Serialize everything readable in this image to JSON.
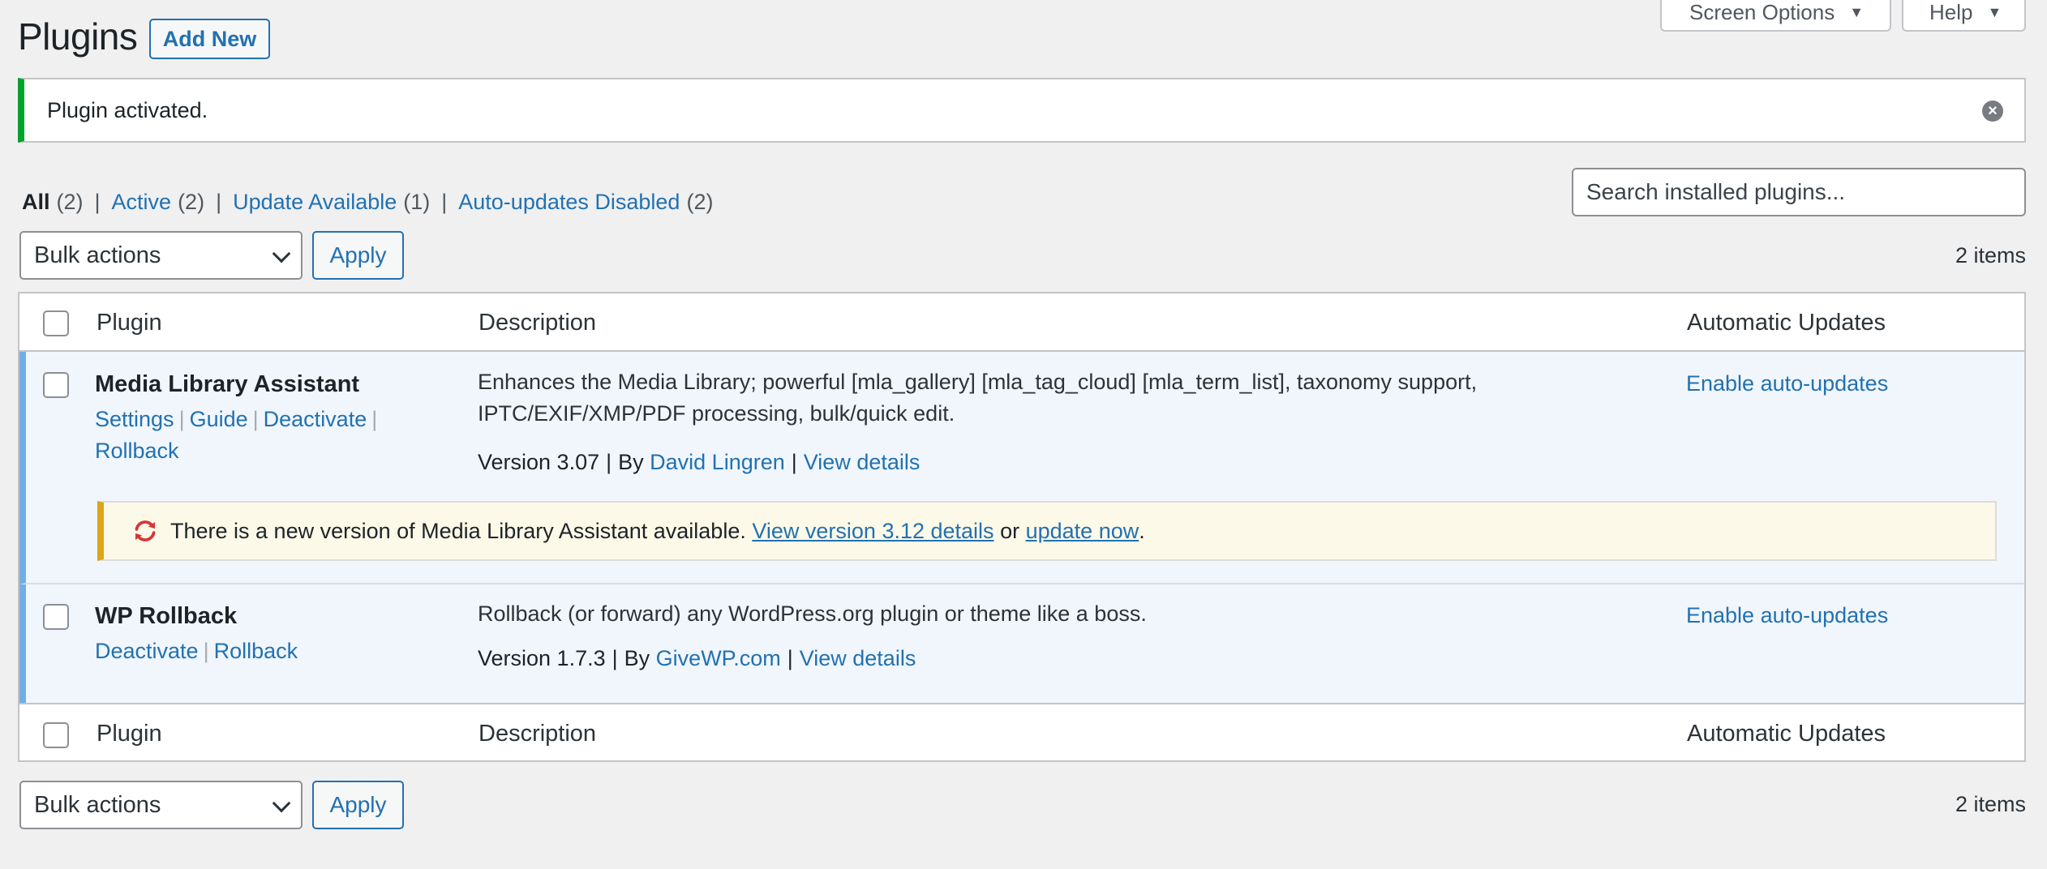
{
  "screen_options": {
    "label": "Screen Options"
  },
  "help": {
    "label": "Help"
  },
  "page": {
    "title": "Plugins",
    "add_new": "Add New"
  },
  "notice": {
    "message": "Plugin activated."
  },
  "filters": {
    "all": {
      "label": "All",
      "count": "(2)"
    },
    "active": {
      "label": "Active",
      "count": "(2)"
    },
    "update_available": {
      "label": "Update Available",
      "count": "(1)"
    },
    "auto_updates_disabled": {
      "label": "Auto-updates Disabled",
      "count": "(2)"
    }
  },
  "search": {
    "placeholder": "Search installed plugins..."
  },
  "bulk": {
    "selected": "Bulk actions",
    "apply": "Apply",
    "items": "2 items"
  },
  "columns": {
    "plugin": "Plugin",
    "description": "Description",
    "auto_updates": "Automatic Updates"
  },
  "plugins": [
    {
      "name": "Media Library Assistant",
      "actions": [
        "Settings",
        "Guide",
        "Deactivate",
        "Rollback"
      ],
      "description_line1": "Enhances the Media Library; powerful [mla_gallery] [mla_tag_cloud] [mla_term_list], taxonomy support,",
      "description_line2": "IPTC/EXIF/XMP/PDF processing, bulk/quick edit.",
      "version": "Version 3.07",
      "by": "By",
      "author": "David Lingren",
      "view_details": "View details",
      "auto_updates": "Enable auto-updates",
      "update": {
        "text": "There is a new version of Media Library Assistant available.",
        "details_link": "View version 3.12 details",
        "or": "or",
        "update_link": "update now",
        "period": "."
      }
    },
    {
      "name": "WP Rollback",
      "actions": [
        "Deactivate",
        "Rollback"
      ],
      "description_line1": "Rollback (or forward) any WordPress.org plugin or theme like a boss.",
      "version": "Version 1.7.3",
      "by": "By",
      "author": "GiveWP.com",
      "view_details": "View details",
      "auto_updates": "Enable auto-updates"
    }
  ],
  "colors": {
    "accent": "#2271b1",
    "success": "#00a32a",
    "warning": "#dba617",
    "active_row": "#f0f6fc",
    "update_icon": "#d63638"
  },
  "icons": {
    "dismiss": "close-circle-icon",
    "update": "refresh-icon",
    "dropdown": "chevron-down-icon",
    "menu_toggle": "triangle-down-icon"
  }
}
